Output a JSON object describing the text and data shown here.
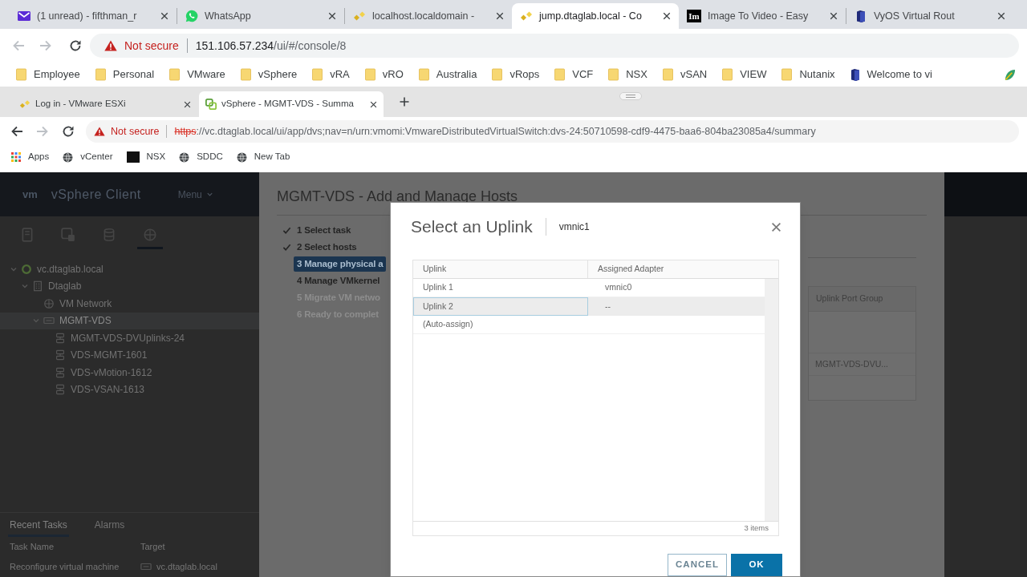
{
  "browser": {
    "tabs": [
      {
        "kind": "mail",
        "title": "(1 unread) - fifthman_r",
        "selected": false
      },
      {
        "kind": "chat",
        "title": "WhatsApp",
        "selected": false
      },
      {
        "kind": "diamonds",
        "title": "localhost.localdomain -",
        "selected": false
      },
      {
        "kind": "diamonds",
        "title": "jump.dtaglab.local - Co",
        "selected": true
      },
      {
        "kind": "logo",
        "icon_text": "Im",
        "title": "Image To Video - Easy",
        "selected": false
      },
      {
        "kind": "server",
        "title": "VyOS Virtual Rout",
        "selected": false
      }
    ],
    "address": {
      "warning": "Not secure",
      "host": "151.106.57.234",
      "path": "/ui/#/console/8"
    },
    "bookmarks": [
      {
        "kind": "folder",
        "label": "Employee"
      },
      {
        "kind": "folder",
        "label": "Personal"
      },
      {
        "kind": "folder",
        "label": "VMware"
      },
      {
        "kind": "folder",
        "label": "vSphere"
      },
      {
        "kind": "folder",
        "label": "vRA"
      },
      {
        "kind": "folder",
        "label": "vRO"
      },
      {
        "kind": "folder",
        "label": "Australia"
      },
      {
        "kind": "folder",
        "label": "vRops"
      },
      {
        "kind": "folder",
        "label": "VCF"
      },
      {
        "kind": "folder",
        "label": "NSX"
      },
      {
        "kind": "folder",
        "label": "vSAN"
      },
      {
        "kind": "folder",
        "label": "VIEW"
      },
      {
        "kind": "folder",
        "label": "Nutanix"
      },
      {
        "kind": "server",
        "label": "Welcome to vi"
      },
      {
        "kind": "leaf"
      }
    ]
  },
  "remote_browser": {
    "tabs": [
      {
        "kind": "diamonds",
        "title": "Log in - VMware ESXi",
        "selected": false
      },
      {
        "kind": "squares",
        "title": "vSphere - MGMT-VDS - Summa",
        "selected": true
      }
    ],
    "address": {
      "warning": "Not secure",
      "scheme": "https",
      "rest": "://vc.dtaglab.local/ui/app/dvs;nav=n/urn:vmomi:VmwareDistributedVirtualSwitch:dvs-24:50710598-cdf9-4475-baa6-804ba23085a4/summary"
    },
    "bookmarks": [
      {
        "kind": "apps",
        "label": "Apps"
      },
      {
        "kind": "globe",
        "label": "vCenter"
      },
      {
        "kind": "square",
        "label": "NSX"
      },
      {
        "kind": "globe",
        "label": "SDDC"
      },
      {
        "kind": "globe",
        "label": "New Tab"
      }
    ]
  },
  "vsphere": {
    "logo": "vm",
    "product": "vSphere Client",
    "menu": "Menu",
    "nav_tabs": [
      {
        "kind": "host",
        "selected": false
      },
      {
        "kind": "vm",
        "selected": false
      },
      {
        "kind": "database",
        "selected": false
      },
      {
        "kind": "network",
        "selected": true
      }
    ],
    "tree": [
      {
        "kind": "vcenter",
        "label": "vc.dtaglab.local",
        "selected": false,
        "expanded": true,
        "children": [
          {
            "kind": "datacenter",
            "label": "Dtaglab",
            "selected": false,
            "expanded": true,
            "children": [
              {
                "kind": "network",
                "label": "VM Network",
                "selected": false
              },
              {
                "kind": "switch",
                "label": "MGMT-VDS",
                "selected": true,
                "expanded": true,
                "children": [
                  {
                    "kind": "portgroup",
                    "label": "MGMT-VDS-DVUplinks-24",
                    "selected": false
                  },
                  {
                    "kind": "portgroup",
                    "label": "VDS-MGMT-1601",
                    "selected": false
                  },
                  {
                    "kind": "portgroup",
                    "label": "VDS-vMotion-1612",
                    "selected": false
                  },
                  {
                    "kind": "portgroup",
                    "label": "VDS-VSAN-1613",
                    "selected": false
                  }
                ]
              }
            ]
          }
        ]
      }
    ],
    "bottom_tabs": [
      {
        "label": "Recent Tasks",
        "selected": true
      },
      {
        "label": "Alarms",
        "selected": false
      }
    ],
    "tasks": {
      "columns": [
        "Task Name",
        "Target"
      ],
      "rows": [
        {
          "task": "Reconfigure virtual machine",
          "target": "vc.dtaglab.local"
        }
      ]
    }
  },
  "wizard": {
    "title": "MGMT-VDS - Add and Manage Hosts",
    "steps": [
      {
        "label": "1 Select task",
        "done": true,
        "selected": false,
        "disabled": false
      },
      {
        "label": "2 Select hosts",
        "done": true,
        "selected": false,
        "disabled": false
      },
      {
        "label": "3 Manage physical a",
        "done": false,
        "selected": true,
        "disabled": false
      },
      {
        "label": "4 Manage VMkernel",
        "done": false,
        "selected": false,
        "disabled": false
      },
      {
        "label": "5 Migrate VM netwo",
        "done": false,
        "selected": false,
        "disabled": true
      },
      {
        "label": "6 Ready to complet",
        "done": false,
        "selected": false,
        "disabled": true
      }
    ],
    "side_table": {
      "column": "Uplink Port Group",
      "cell": "MGMT-VDS-DVU..."
    }
  },
  "dialog": {
    "title": "Select an Uplink",
    "subtitle": "vmnic1",
    "columns": [
      "Uplink",
      "Assigned Adapter"
    ],
    "rows": [
      {
        "cells": [
          "Uplink 1",
          "vmnic0"
        ],
        "selected": false
      },
      {
        "cells": [
          "Uplink 2",
          "--"
        ],
        "selected": true
      },
      {
        "cells": [
          "(Auto-assign)"
        ],
        "selected": false
      }
    ],
    "footer": "3 items",
    "buttons": [
      {
        "label": "CANCEL",
        "kind": "outline"
      },
      {
        "label": "OK",
        "kind": "filled"
      }
    ]
  }
}
